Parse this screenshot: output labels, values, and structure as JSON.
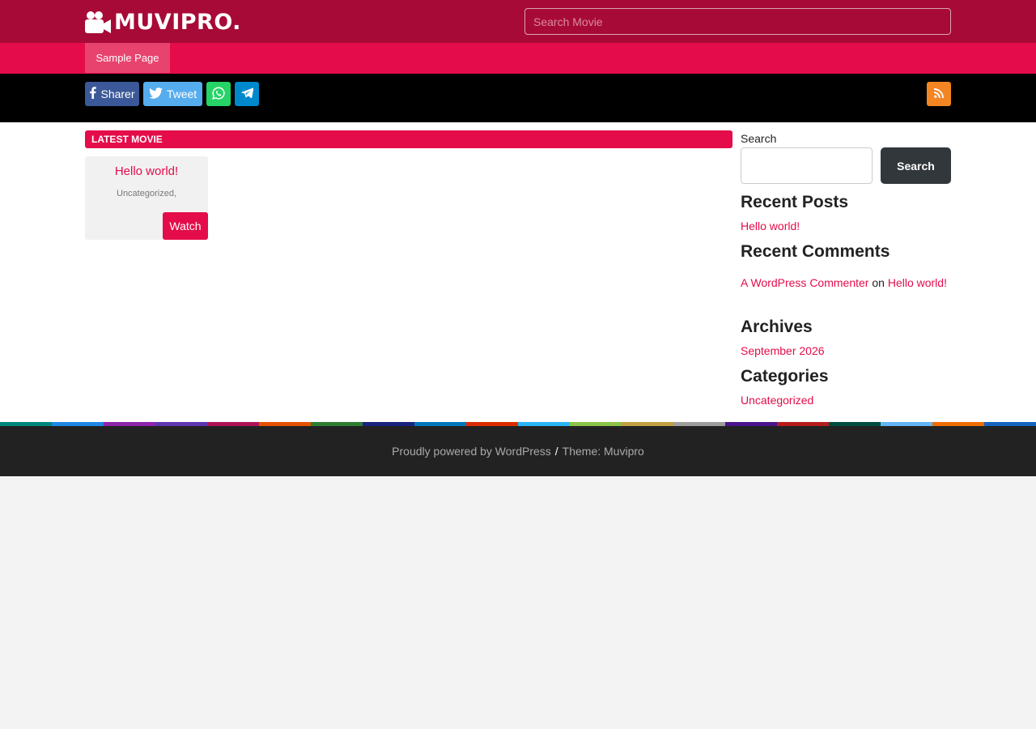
{
  "header": {
    "logo_text": "MUVIPRO.",
    "logo_icon": "video-camera-icon",
    "search_placeholder": "Search Movie"
  },
  "nav": {
    "items": [
      {
        "label": "Sample Page"
      }
    ]
  },
  "share": {
    "facebook_label": "Sharer",
    "twitter_label": "Tweet",
    "whatsapp_icon": "whatsapp-icon",
    "telegram_icon": "telegram-icon",
    "rss_icon": "rss-icon"
  },
  "main": {
    "section_title": "LATEST MOVIE",
    "movies": [
      {
        "title": "Hello world!",
        "category": "Uncategorized,",
        "action": "Watch"
      }
    ]
  },
  "sidebar": {
    "search_label": "Search",
    "search_button": "Search",
    "recent_posts": {
      "heading": "Recent Posts",
      "items": [
        "Hello world!"
      ]
    },
    "recent_comments": {
      "heading": "Recent Comments",
      "items": [
        {
          "author": "A WordPress Commenter",
          "on": "on",
          "post": "Hello world!"
        }
      ]
    },
    "archives": {
      "heading": "Archives",
      "items": [
        "September 2026"
      ]
    },
    "categories": {
      "heading": "Categories",
      "items": [
        "Uncategorized"
      ]
    }
  },
  "colors": {
    "brand_dark": "#a80a37",
    "brand": "#e40c4a",
    "stripe": [
      "#00897b",
      "#1e88e5",
      "#8e24aa",
      "#5e35b1",
      "#ad1457",
      "#e65100",
      "#2e7d32",
      "#1a237e",
      "#0277bd",
      "#dd2c00",
      "#29b6f6",
      "#8bc34a",
      "#c0a044",
      "#9e9e9e",
      "#4a148c",
      "#b71c1c",
      "#004d40",
      "#64b5f6",
      "#ef6c00",
      "#1565c0"
    ]
  },
  "footer": {
    "powered": "Proudly powered by WordPress",
    "separator": "/",
    "theme": "Theme: Muvipro"
  }
}
